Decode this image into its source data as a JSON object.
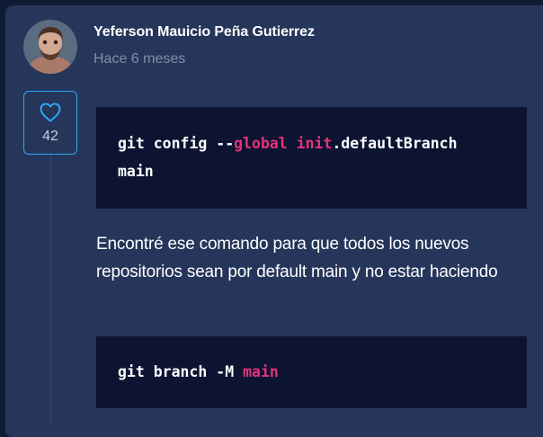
{
  "comment": {
    "author": "Yeferson Mauicio Peña Gutierrez",
    "time": "Hace 6 meses",
    "likes": "42",
    "like_icon": "heart-outline-icon"
  },
  "code_blocks": [
    {
      "line1": {
        "plain1": "git config --",
        "kw1": "global",
        "kw2": "init",
        "plain2": ".defaultBranch"
      },
      "line2": "main"
    },
    {
      "plain": "git branch -M ",
      "kw": "main"
    }
  ],
  "paragraph": "Encontré ese comando para que todos los nuevos repositorios sean por default main y no estar haciendo",
  "colors": {
    "background": "#0f1a34",
    "card": "#25365a",
    "code_bg": "#0c1432",
    "keyword": "#e7327a",
    "like_border": "#2ea7f2",
    "muted_text": "#7f8ea8"
  }
}
